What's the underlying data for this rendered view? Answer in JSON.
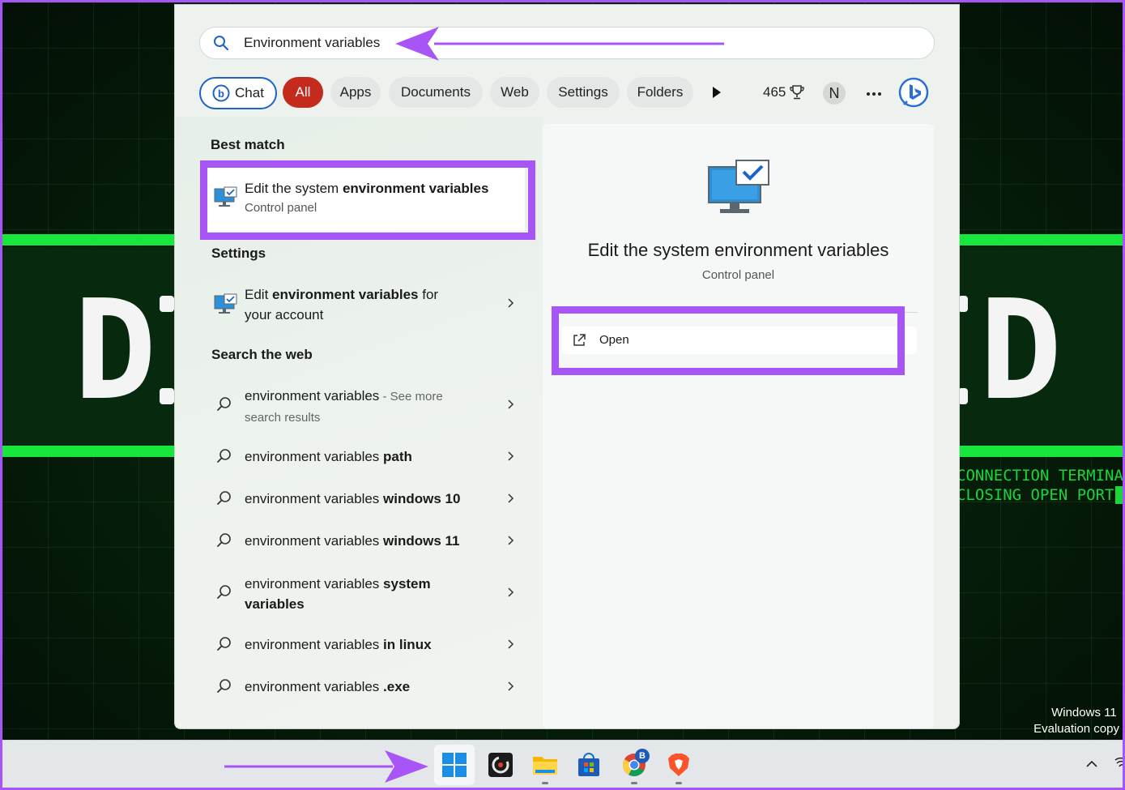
{
  "background": {
    "terminal_lines": [
      "CONNECTION TERMINAT",
      "CLOSING OPEN PORTS"
    ],
    "watermark": [
      "Windows 11",
      "Evaluation copy"
    ]
  },
  "search": {
    "query": "Environment variables"
  },
  "filters": [
    "Chat",
    "All",
    "Apps",
    "Documents",
    "Web",
    "Settings",
    "Folders"
  ],
  "rewards": {
    "points": "465"
  },
  "profile": {
    "initial": "N"
  },
  "best_match": {
    "heading": "Best match",
    "title_plain": "Edit the system ",
    "title_bold": "environment variables",
    "subtitle": "Control panel"
  },
  "settings_section": {
    "heading": "Settings",
    "item_pre": "Edit ",
    "item_bold": "environment variables",
    "item_post": " for",
    "item_line2": "your account"
  },
  "web_section": {
    "heading": "Search the web",
    "results": [
      {
        "plain": "environment variables",
        "bold": "",
        "extra": " - See more",
        "line2": "search results"
      },
      {
        "plain": "environment variables ",
        "bold": "path",
        "extra": "",
        "line2": ""
      },
      {
        "plain": "environment variables ",
        "bold": "windows 10",
        "extra": "",
        "line2": ""
      },
      {
        "plain": "environment variables ",
        "bold": "windows 11",
        "extra": "",
        "line2": ""
      },
      {
        "plain": "environment variables ",
        "bold": "system",
        "extra": "",
        "line2": "variables"
      },
      {
        "plain": "environment variables ",
        "bold": "in linux",
        "extra": "",
        "line2": ""
      },
      {
        "plain": "environment variables ",
        "bold": ".exe",
        "extra": "",
        "line2": ""
      }
    ]
  },
  "preview": {
    "title": "Edit the system environment variables",
    "subtitle": "Control panel",
    "open_label": "Open"
  },
  "taskbar": {
    "apps": [
      "start-icon",
      "app-icon",
      "file-explorer-icon",
      "store-icon",
      "chrome-icon",
      "brave-icon"
    ],
    "chrome_badge": "B"
  },
  "colors": {
    "highlight": "#a855f7",
    "accent": "#1f63c9",
    "all_filter": "#c42b1c"
  }
}
